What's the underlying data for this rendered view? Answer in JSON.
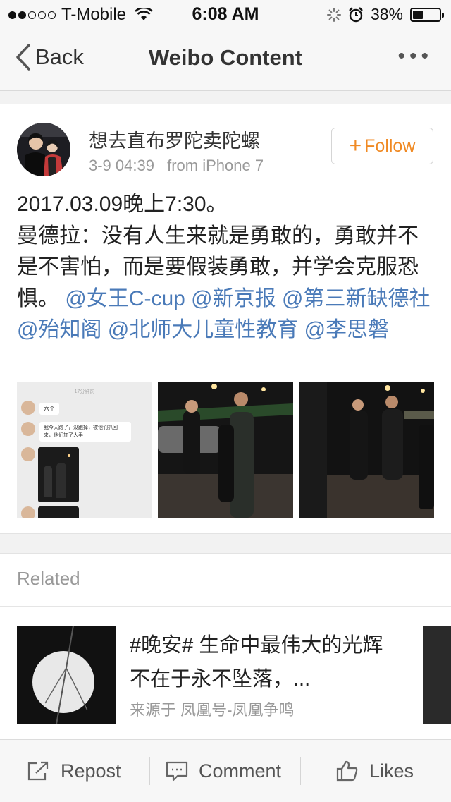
{
  "status_bar": {
    "carrier": "T-Mobile",
    "time": "6:08 AM",
    "battery": "38%",
    "battery_level": 0.38
  },
  "nav": {
    "back_label": "Back",
    "title": "Weibo Content",
    "more_icon": "ellipsis-icon"
  },
  "post": {
    "username": "想去直布罗陀卖陀螺",
    "date": "3-9 04:39",
    "source": "from iPhone 7",
    "follow_label": "Follow",
    "text_line1": "2017.03.09晚上7:30。",
    "text_line2": "曼德拉：没有人生来就是勇敢的，勇敢并不是不害怕，而是要假装勇敢，并学会克服恐惧。",
    "mentions": [
      "@女王C-cup",
      "@新京报",
      "@第三新缺德社",
      "@殆知阁",
      "@北师大儿童性教育",
      "@李思磐"
    ],
    "image_chat": {
      "header": "17分钟前",
      "msg1": "六个",
      "msg2": "我今天跑了，没跑掉，被他们抓回来，他们加了人手"
    }
  },
  "related": {
    "heading": "Related",
    "item_title": "#晚安# 生命中最伟大的光辉不在于永不坠落，...",
    "item_source": "来源于 凤凰号-凤凰争鸣"
  },
  "toolbar": {
    "repost": "Repost",
    "comment": "Comment",
    "likes": "Likes"
  },
  "colors": {
    "accent_orange": "#f08a24",
    "mention_blue": "#4a7ab8"
  }
}
